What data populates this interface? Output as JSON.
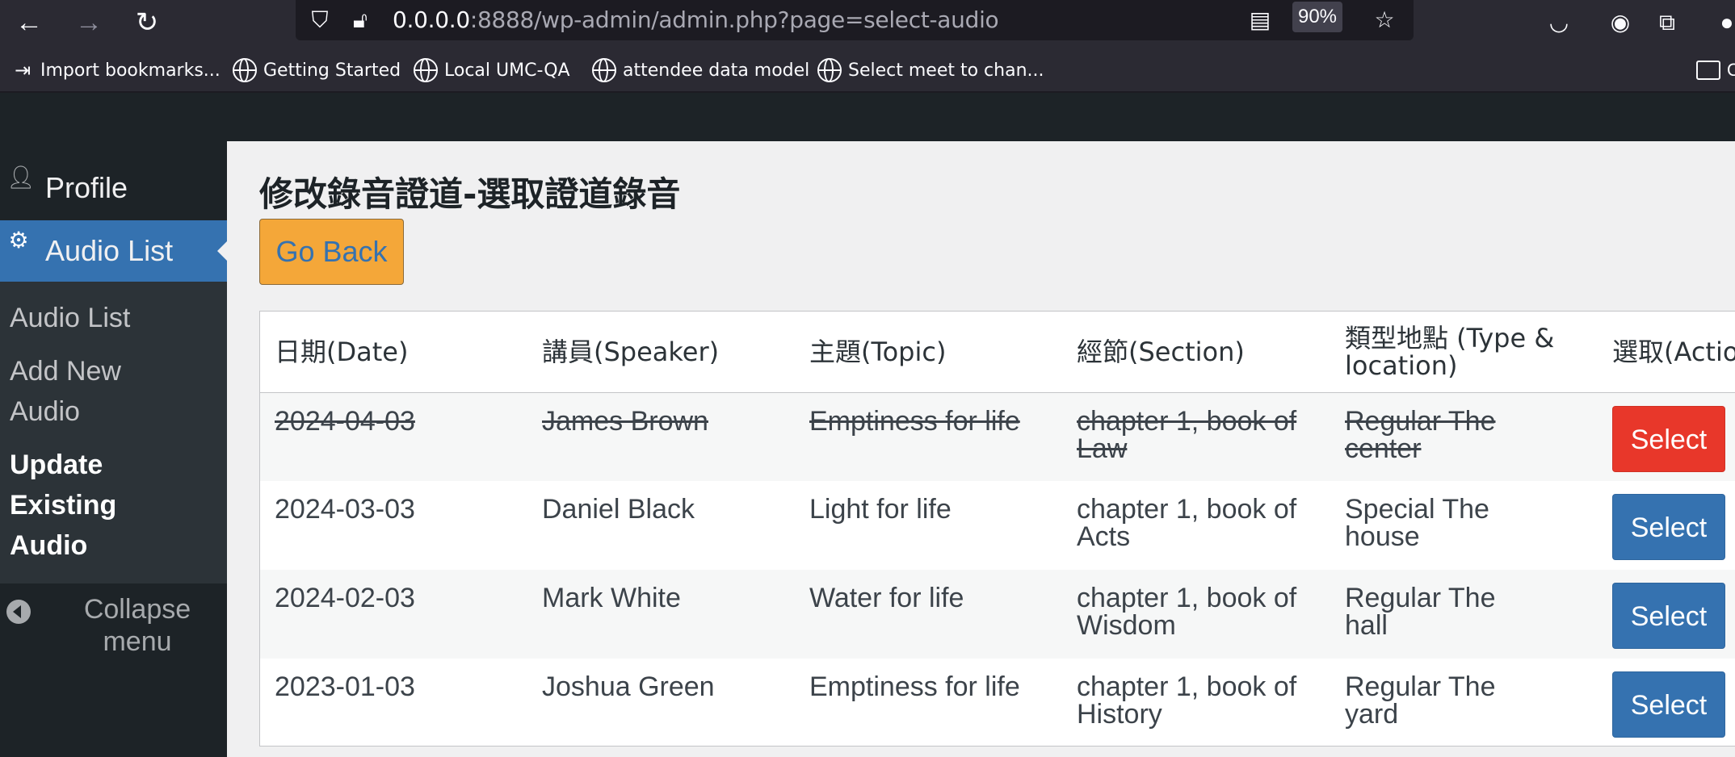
{
  "browser": {
    "url_host": "0.0.0.0",
    "url_rest": ":8888/wp-admin/admin.php?page=select-audio",
    "zoom_level": "90%",
    "bookmarks": [
      {
        "label": "Import bookmarks...",
        "icon": "import-icon"
      },
      {
        "label": "Getting Started",
        "icon": "globe-icon"
      },
      {
        "label": "Local UMC-QA",
        "icon": "globe-icon"
      },
      {
        "label": "attendee data model",
        "icon": "globe-icon"
      },
      {
        "label": "Select meet to chan...",
        "icon": "globe-icon"
      }
    ],
    "other_bookmarks_label": "O"
  },
  "sidebar": {
    "profile_label": "Profile",
    "audio_list_label": "Audio List",
    "submenu": [
      {
        "label": "Audio List",
        "current": false
      },
      {
        "label": "Add New Audio",
        "current": false
      },
      {
        "label": "Update Existing Audio",
        "current": true
      }
    ],
    "collapse_label": "Collapse menu"
  },
  "main": {
    "title": "修改錄音證道-選取證道錄音",
    "go_back_label": "Go Back",
    "go_back_color": "#f4a739",
    "table": {
      "headers": [
        "日期(Date)",
        "講員(Speaker)",
        "主題(Topic)",
        "經節(Section)",
        "類型地點 (Type & location)",
        "選取(Action)"
      ],
      "rows": [
        {
          "date": "2024-04-03",
          "speaker": "James Brown",
          "topic": "Emptiness for life",
          "section": "chapter 1, book of Law",
          "type_location": "Regular The center",
          "action": "Select",
          "deleted": true,
          "button_color": "#e8372a"
        },
        {
          "date": "2024-03-03",
          "speaker": "Daniel Black",
          "topic": "Light for life",
          "section": "chapter 1, book of Acts",
          "type_location": "Special The house",
          "action": "Select",
          "deleted": false,
          "button_color": "#3572b0"
        },
        {
          "date": "2024-02-03",
          "speaker": "Mark White",
          "topic": "Water for life",
          "section": "chapter 1, book of Wisdom",
          "type_location": "Regular The hall",
          "action": "Select",
          "deleted": false,
          "button_color": "#3572b0"
        },
        {
          "date": "2023-01-03",
          "speaker": "Joshua Green",
          "topic": "Emptiness for life",
          "section": "chapter 1, book of History",
          "type_location": "Regular The yard",
          "action": "Select",
          "deleted": false,
          "button_color": "#3572b0"
        }
      ]
    }
  }
}
